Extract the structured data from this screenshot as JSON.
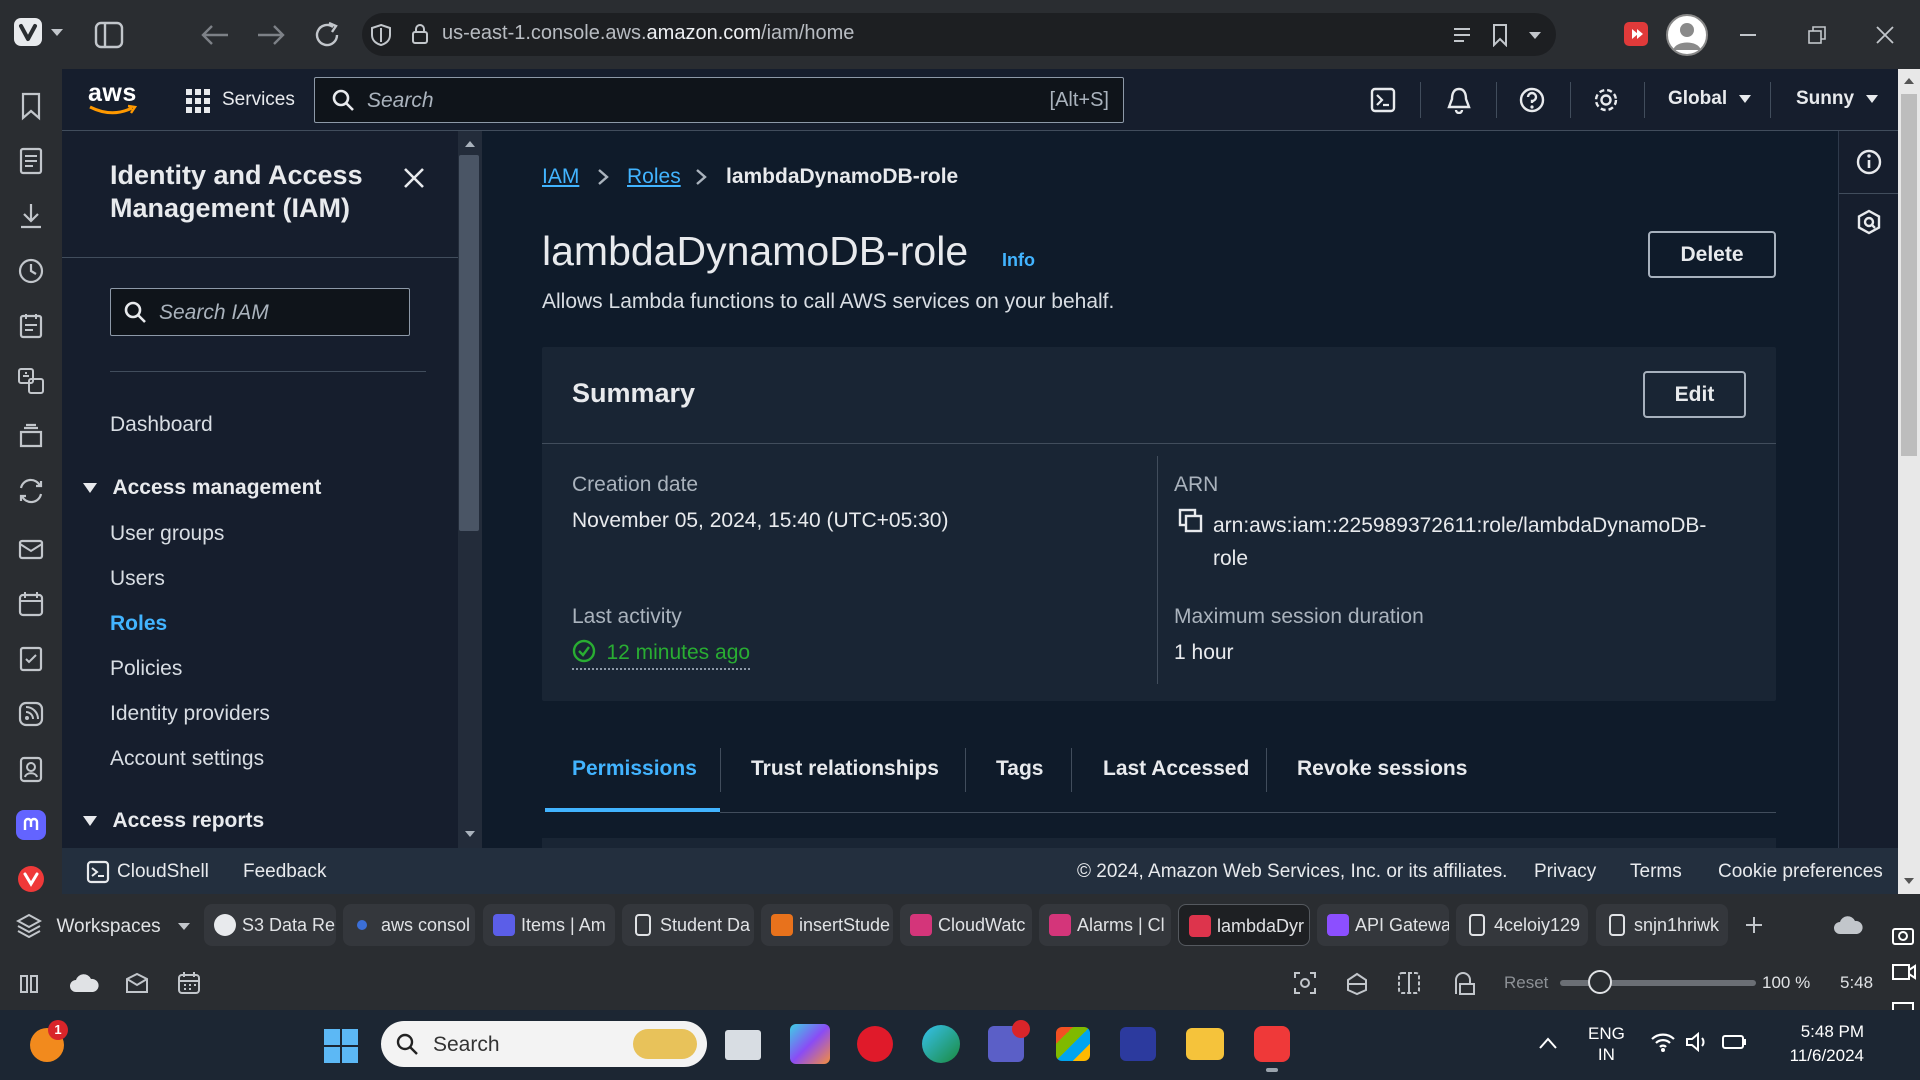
{
  "browser": {
    "url_prefix": "us-east-1.console.aws.",
    "url_domain": "amazon.com",
    "url_path": "/iam/home"
  },
  "aws_nav": {
    "logo": "aws",
    "services": "Services",
    "search_placeholder": "Search",
    "search_shortcut": "[Alt+S]",
    "region": "Global",
    "user": "Sunny"
  },
  "sidebar": {
    "title_line1": "Identity and Access",
    "title_line2": "Management (IAM)",
    "search_placeholder": "Search IAM",
    "dashboard": "Dashboard",
    "section_access_management": "Access management",
    "items": [
      "User groups",
      "Users",
      "Roles",
      "Policies",
      "Identity providers",
      "Account settings"
    ],
    "active_item": "Roles",
    "section_access_reports": "Access reports"
  },
  "breadcrumb": {
    "iam": "IAM",
    "roles": "Roles",
    "current": "lambdaDynamoDB-role"
  },
  "page": {
    "title": "lambdaDynamoDB-role",
    "info": "Info",
    "description": "Allows Lambda functions to call AWS services on your behalf.",
    "delete_button": "Delete"
  },
  "summary": {
    "heading": "Summary",
    "edit_button": "Edit",
    "creation_date_label": "Creation date",
    "creation_date": "November 05, 2024, 15:40 (UTC+05:30)",
    "arn_label": "ARN",
    "arn_line1": "arn:aws:iam::225989372611:role/lambdaDynamoDB-",
    "arn_line2": "role",
    "last_activity_label": "Last activity",
    "last_activity": "12 minutes ago",
    "max_session_label": "Maximum session duration",
    "max_session": "1 hour"
  },
  "tabs": [
    "Permissions",
    "Trust relationships",
    "Tags",
    "Last Accessed",
    "Revoke sessions"
  ],
  "active_tab": "Permissions",
  "footer": {
    "cloudshell": "CloudShell",
    "feedback": "Feedback",
    "copyright": "© 2024, Amazon Web Services, Inc. or its affiliates.",
    "privacy": "Privacy",
    "terms": "Terms",
    "cookie": "Cookie preferences"
  },
  "browser_tabs": {
    "workspaces": "Workspaces",
    "items": [
      "S3 Data Re",
      "aws consol",
      "Items | Am",
      "Student Da",
      "insertStude",
      "CloudWatc",
      "Alarms | Cl",
      "lambdaDyr",
      "API Gatewa",
      "4celoiy129",
      "snjn1hriwk"
    ]
  },
  "statusbar": {
    "reset": "Reset",
    "zoom": "100 %",
    "time": "5:48"
  },
  "taskbar": {
    "search": "Search",
    "lang_line1": "ENG",
    "lang_line2": "IN",
    "time": "5:48 PM",
    "date": "11/6/2024",
    "notification_count": "1"
  },
  "colors": {
    "accent_blue": "#42b4ff",
    "success_green": "#29ad32",
    "aws_orange": "#ff9900",
    "vivaldi_red": "#ef3939"
  }
}
